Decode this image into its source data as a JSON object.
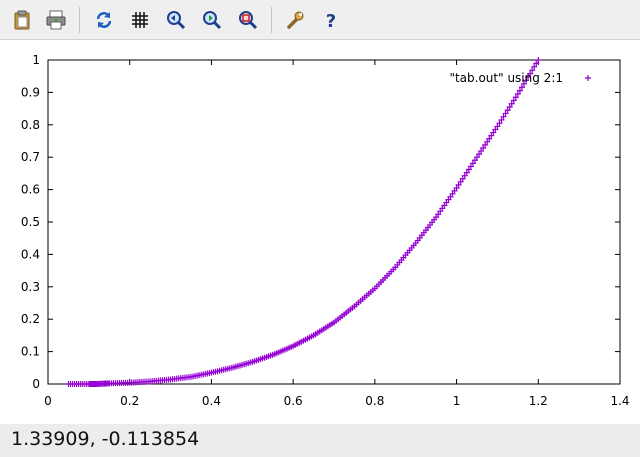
{
  "toolbar": {
    "buttons": [
      {
        "name": "copy-to-clipboard-button",
        "icon": "clipboard-icon"
      },
      {
        "name": "print-button",
        "icon": "printer-icon"
      },
      {
        "name": "replot-button",
        "icon": "refresh-icon"
      },
      {
        "name": "toggle-grid-button",
        "icon": "grid-icon"
      },
      {
        "name": "previous-zoom-button",
        "icon": "zoom-back-icon"
      },
      {
        "name": "next-zoom-button",
        "icon": "zoom-forward-icon"
      },
      {
        "name": "autoscale-button",
        "icon": "zoom-autoscale-icon"
      },
      {
        "name": "settings-button",
        "icon": "wrench-icon"
      },
      {
        "name": "help-button",
        "icon": "question-icon"
      }
    ]
  },
  "chart_data": {
    "type": "scatter",
    "xlim": [
      0,
      1.4
    ],
    "ylim": [
      0,
      1
    ],
    "x_ticks": [
      "0",
      "0.2",
      "0.4",
      "0.6",
      "0.8",
      "1",
      "1.2",
      "1.4"
    ],
    "y_ticks": [
      "0",
      "0.1",
      "0.2",
      "0.3",
      "0.4",
      "0.5",
      "0.6",
      "0.7",
      "0.8",
      "0.9",
      "1"
    ],
    "grid": false,
    "legend_position": "top-right",
    "marker": "+",
    "series": [
      {
        "name": "\"tab.out\" using 2:1",
        "color": "#9400d3",
        "points": [
          [
            0.05,
            0.0
          ],
          [
            0.1,
            0.0
          ],
          [
            0.12,
            0.0
          ],
          [
            0.15,
            0.002
          ],
          [
            0.2,
            0.004
          ],
          [
            0.25,
            0.008
          ],
          [
            0.3,
            0.014
          ],
          [
            0.35,
            0.022
          ],
          [
            0.4,
            0.035
          ],
          [
            0.45,
            0.05
          ],
          [
            0.5,
            0.068
          ],
          [
            0.55,
            0.09
          ],
          [
            0.6,
            0.117
          ],
          [
            0.65,
            0.15
          ],
          [
            0.7,
            0.19
          ],
          [
            0.75,
            0.24
          ],
          [
            0.8,
            0.295
          ],
          [
            0.85,
            0.36
          ],
          [
            0.9,
            0.435
          ],
          [
            0.95,
            0.515
          ],
          [
            1.0,
            0.605
          ],
          [
            1.05,
            0.7
          ],
          [
            1.1,
            0.795
          ],
          [
            1.15,
            0.895
          ],
          [
            1.2,
            1.0
          ]
        ]
      }
    ]
  },
  "status": {
    "coordinates": "1.33909, -0.113854"
  }
}
